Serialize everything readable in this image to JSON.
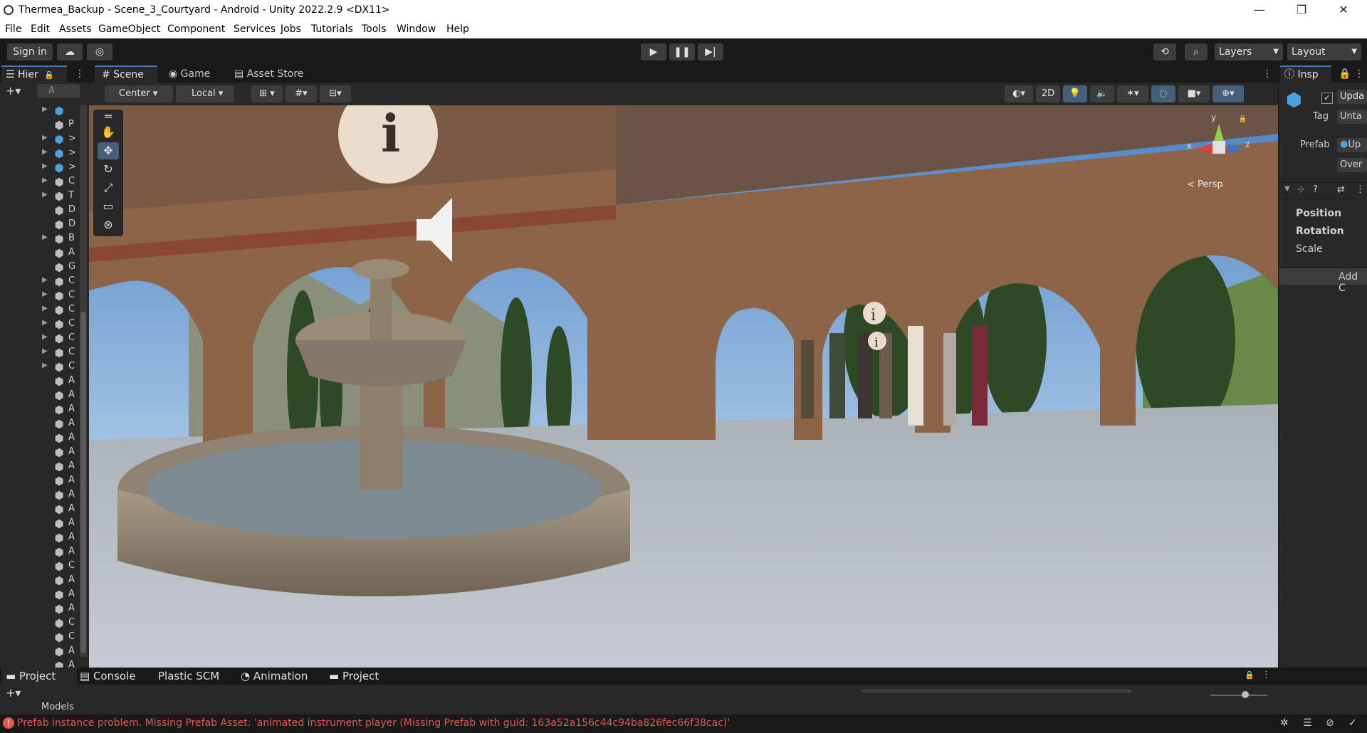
{
  "window": {
    "title": "Thermea_Backup - Scene_3_Courtyard - Android - Unity 2022.2.9 <DX11>",
    "minimize": "—",
    "maximize": "❐",
    "close": "✕"
  },
  "menu": [
    "File",
    "Edit",
    "Assets",
    "GameObject",
    "Component",
    "Services",
    "Jobs",
    "Tutorials",
    "Tools",
    "Window",
    "Help"
  ],
  "toolbar": {
    "sign_in": "Sign in",
    "layers": "Layers",
    "layout": "Layout"
  },
  "hierarchy": {
    "tab": "Hier",
    "search_placeholder": "A",
    "rows": [
      {
        "label": "",
        "prefab": true,
        "arrow": true
      },
      {
        "label": "P",
        "prefab": false,
        "arrow": false
      },
      {
        "label": ">",
        "prefab": true,
        "arrow": true
      },
      {
        "label": ">",
        "prefab": true,
        "arrow": true
      },
      {
        "label": ">",
        "prefab": true,
        "arrow": true
      },
      {
        "label": "C",
        "prefab": false,
        "arrow": true
      },
      {
        "label": "T",
        "prefab": false,
        "arrow": true
      },
      {
        "label": "D",
        "prefab": false,
        "arrow": false
      },
      {
        "label": "D",
        "prefab": false,
        "arrow": false
      },
      {
        "label": "B",
        "prefab": false,
        "arrow": true
      },
      {
        "label": "A",
        "prefab": false,
        "arrow": false
      },
      {
        "label": "G",
        "prefab": false,
        "arrow": false
      },
      {
        "label": "C",
        "prefab": false,
        "arrow": true
      },
      {
        "label": "C",
        "prefab": false,
        "arrow": true
      },
      {
        "label": "C",
        "prefab": false,
        "arrow": true
      },
      {
        "label": "C",
        "prefab": false,
        "arrow": true
      },
      {
        "label": "C",
        "prefab": false,
        "arrow": true
      },
      {
        "label": "C",
        "prefab": false,
        "arrow": true
      },
      {
        "label": "C",
        "prefab": false,
        "arrow": true
      },
      {
        "label": "A",
        "prefab": false,
        "arrow": false
      },
      {
        "label": "A",
        "prefab": false,
        "arrow": false
      },
      {
        "label": "A",
        "prefab": false,
        "arrow": false
      },
      {
        "label": "A",
        "prefab": false,
        "arrow": false
      },
      {
        "label": "A",
        "prefab": false,
        "arrow": false
      },
      {
        "label": "A",
        "prefab": false,
        "arrow": false
      },
      {
        "label": "A",
        "prefab": false,
        "arrow": false
      },
      {
        "label": "A",
        "prefab": false,
        "arrow": false
      },
      {
        "label": "A",
        "prefab": false,
        "arrow": false
      },
      {
        "label": "A",
        "prefab": false,
        "arrow": false
      },
      {
        "label": "A",
        "prefab": false,
        "arrow": false
      },
      {
        "label": "A",
        "prefab": false,
        "arrow": false
      },
      {
        "label": "A",
        "prefab": false,
        "arrow": false
      },
      {
        "label": "C",
        "prefab": false,
        "arrow": false
      },
      {
        "label": "A",
        "prefab": false,
        "arrow": false
      },
      {
        "label": "A",
        "prefab": false,
        "arrow": false
      },
      {
        "label": "A",
        "prefab": false,
        "arrow": false
      },
      {
        "label": "C",
        "prefab": false,
        "arrow": false
      },
      {
        "label": "C",
        "prefab": false,
        "arrow": false
      },
      {
        "label": "A",
        "prefab": false,
        "arrow": false
      },
      {
        "label": "A",
        "prefab": false,
        "arrow": false
      },
      {
        "label": ">",
        "prefab": true,
        "arrow": true
      },
      {
        "label": ">",
        "prefab": true,
        "arrow": true
      }
    ]
  },
  "scene": {
    "tabs": [
      "Scene",
      "Game",
      "Asset Store"
    ],
    "pivot": "Center",
    "space": "Local",
    "mode_2d": "2D",
    "projection": "< Persp",
    "axis_x": "x",
    "axis_y": "y",
    "axis_z": "z"
  },
  "inspector": {
    "tab": "Insp",
    "name_value": "Upda",
    "tag_label": "Tag",
    "tag_value": "Unta",
    "prefab_label": "Prefab",
    "prefab_value": "Up",
    "overrides": "Over",
    "position": "Position",
    "rotation": "Rotation",
    "scale": "Scale",
    "add_component": "Add C"
  },
  "bottom": {
    "tabs": [
      "Project",
      "Console",
      "Plastic SCM",
      "Animation",
      "Project"
    ],
    "folder": "Models"
  },
  "status": {
    "error": "Prefab instance problem. Missing Prefab Asset: 'animated instrument player (Missing Prefab with guid: 163a52a156c44c94ba826fec66f38cac)'",
    "error_color": "#e05a4e"
  }
}
